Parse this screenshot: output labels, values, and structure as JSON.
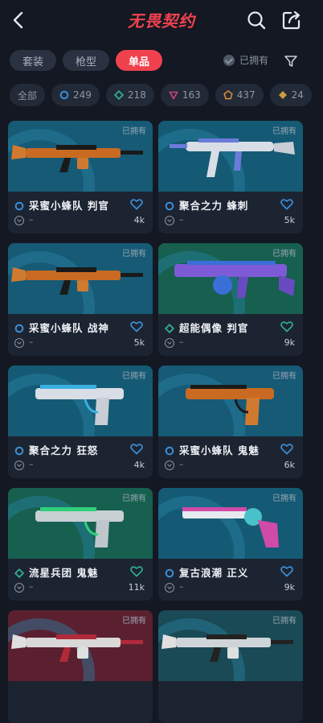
{
  "header": {
    "title": "无畏契约"
  },
  "tabs": [
    {
      "label": "套装",
      "active": false
    },
    {
      "label": "枪型",
      "active": false
    },
    {
      "label": "单品",
      "active": true
    }
  ],
  "owned_filter": {
    "label": "已拥有"
  },
  "tier_chips": [
    {
      "label": "全部",
      "icon": ""
    },
    {
      "label": "249",
      "icon": "tier-select-icon",
      "color": "#3b8fd8"
    },
    {
      "label": "218",
      "icon": "tier-deluxe-icon",
      "color": "#2fae8e"
    },
    {
      "label": "163",
      "icon": "tier-premium-icon",
      "color": "#c8467a"
    },
    {
      "label": "437",
      "icon": "tier-ultra-icon",
      "color": "#d8893a"
    },
    {
      "label": "24",
      "icon": "tier-exclusive-icon",
      "color": "#e6b23e"
    }
  ],
  "cards": [
    {
      "owned": "已拥有",
      "name": "采蜜小蜂队 判官",
      "tier": "tier-select-icon",
      "tier_color": "#3b8fd8",
      "sub": "–",
      "count": "4k",
      "fav_color": "#3b8fd8"
    },
    {
      "owned": "已拥有",
      "name": "聚合之力 蜂刺",
      "tier": "tier-select-icon",
      "tier_color": "#3b8fd8",
      "sub": "–",
      "count": "5k",
      "fav_color": "#3b8fd8"
    },
    {
      "owned": "已拥有",
      "name": "采蜜小蜂队 战神",
      "tier": "tier-select-icon",
      "tier_color": "#3b8fd8",
      "sub": "–",
      "count": "5k",
      "fav_color": "#3b8fd8"
    },
    {
      "owned": "已拥有",
      "name": "超能偶像 判官",
      "tier": "tier-deluxe-icon",
      "tier_color": "#2fae8e",
      "sub": "–",
      "count": "9k",
      "fav_color": "#2fae8e"
    },
    {
      "owned": "已拥有",
      "name": "聚合之力 狂怒",
      "tier": "tier-select-icon",
      "tier_color": "#3b8fd8",
      "sub": "–",
      "count": "4k",
      "fav_color": "#3b8fd8"
    },
    {
      "owned": "已拥有",
      "name": "采蜜小蜂队 鬼魅",
      "tier": "tier-select-icon",
      "tier_color": "#3b8fd8",
      "sub": "–",
      "count": "6k",
      "fav_color": "#3b8fd8"
    },
    {
      "owned": "已拥有",
      "name": "流星兵团 鬼魅",
      "tier": "tier-deluxe-icon",
      "tier_color": "#2fae8e",
      "sub": "–",
      "count": "11k",
      "fav_color": "#2fae8e"
    },
    {
      "owned": "已拥有",
      "name": "复古浪潮 正义",
      "tier": "tier-select-icon",
      "tier_color": "#3b8fd8",
      "sub": "–",
      "count": "9k",
      "fav_color": "#3b8fd8"
    },
    {
      "owned": "已拥有",
      "name": "",
      "tier": "",
      "tier_color": "#3b8fd8",
      "sub": "",
      "count": "",
      "fav_color": "#3b8fd8"
    },
    {
      "owned": "已拥有",
      "name": "",
      "tier": "",
      "tier_color": "#3b8fd8",
      "sub": "",
      "count": "",
      "fav_color": "#3b8fd8"
    }
  ],
  "colors": {
    "accent": "#f0424e",
    "background": "#131822",
    "card": "#1c2330"
  }
}
